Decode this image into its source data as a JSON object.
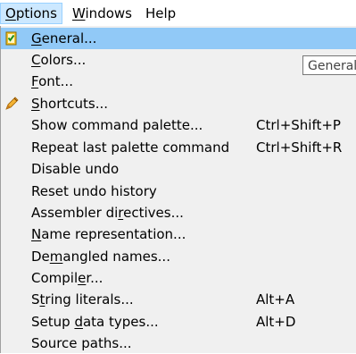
{
  "menubar": {
    "items": [
      {
        "pre": "",
        "accel": "O",
        "post": "ptions"
      },
      {
        "pre": "",
        "accel": "W",
        "post": "indows"
      },
      {
        "pre": "H",
        "accel": "",
        "post": "elp"
      }
    ]
  },
  "menu": {
    "items": [
      {
        "pre": "",
        "accel": "G",
        "post": "eneral...",
        "shortcut": ""
      },
      {
        "pre": "",
        "accel": "C",
        "post": "olors...",
        "shortcut": ""
      },
      {
        "pre": "",
        "accel": "F",
        "post": "ont...",
        "shortcut": ""
      },
      {
        "pre": "",
        "accel": "S",
        "post": "hortcuts...",
        "shortcut": ""
      },
      {
        "pre": "Show command palette...",
        "accel": "",
        "post": "",
        "shortcut": "Ctrl+Shift+P"
      },
      {
        "pre": "Repeat last palette command",
        "accel": "",
        "post": "",
        "shortcut": "Ctrl+Shift+R"
      },
      {
        "pre": "Disable undo",
        "accel": "",
        "post": "",
        "shortcut": ""
      },
      {
        "pre": "Reset undo history",
        "accel": "",
        "post": "",
        "shortcut": ""
      },
      {
        "pre": "Assembler di",
        "accel": "r",
        "post": "ectives...",
        "shortcut": ""
      },
      {
        "pre": "",
        "accel": "N",
        "post": "ame representation...",
        "shortcut": ""
      },
      {
        "pre": "De",
        "accel": "m",
        "post": "angled names...",
        "shortcut": ""
      },
      {
        "pre": "Compil",
        "accel": "e",
        "post": "r...",
        "shortcut": ""
      },
      {
        "pre": "S",
        "accel": "t",
        "post": "ring literals...",
        "shortcut": "Alt+A"
      },
      {
        "pre": "Setup ",
        "accel": "d",
        "post": "ata types...",
        "shortcut": "Alt+D"
      },
      {
        "pre": "Source paths...",
        "accel": "",
        "post": "",
        "shortcut": ""
      }
    ]
  },
  "tooltip": {
    "text": "General"
  },
  "icons": {
    "general": "checklist-icon",
    "shortcuts": "pencil-icon"
  },
  "colors": {
    "highlight": "#91c9f7",
    "menu_bg": "#f0f0f0",
    "menubar_active": "#cce8ff"
  }
}
